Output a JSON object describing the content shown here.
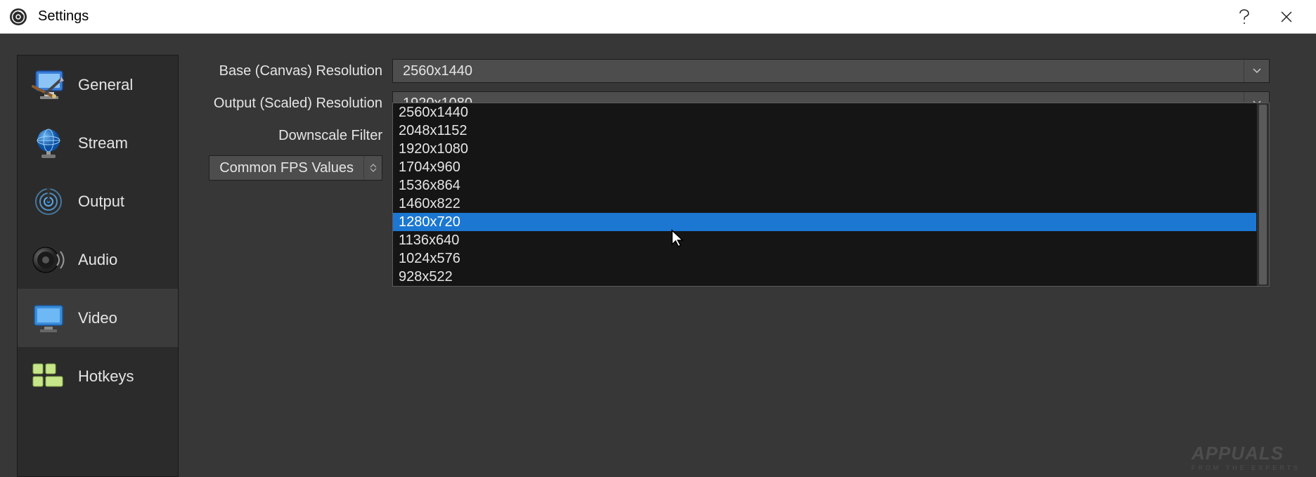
{
  "window": {
    "title": "Settings"
  },
  "sidebar": {
    "items": [
      {
        "label": "General"
      },
      {
        "label": "Stream"
      },
      {
        "label": "Output"
      },
      {
        "label": "Audio"
      },
      {
        "label": "Video"
      },
      {
        "label": "Hotkeys"
      }
    ],
    "selected_index": 4
  },
  "form": {
    "base_label": "Base (Canvas) Resolution",
    "base_value": "2560x1440",
    "output_label": "Output (Scaled) Resolution",
    "output_value": "1920x1080",
    "downscale_label": "Downscale Filter",
    "fps_label": "Common FPS Values"
  },
  "dropdown": {
    "options": [
      "2560x1440",
      "2048x1152",
      "1920x1080",
      "1704x960",
      "1536x864",
      "1460x822",
      "1280x720",
      "1136x640",
      "1024x576",
      "928x522"
    ],
    "highlighted_index": 6
  },
  "watermark": {
    "main": "APPUALS",
    "sub": "FROM THE EXPERTS"
  }
}
